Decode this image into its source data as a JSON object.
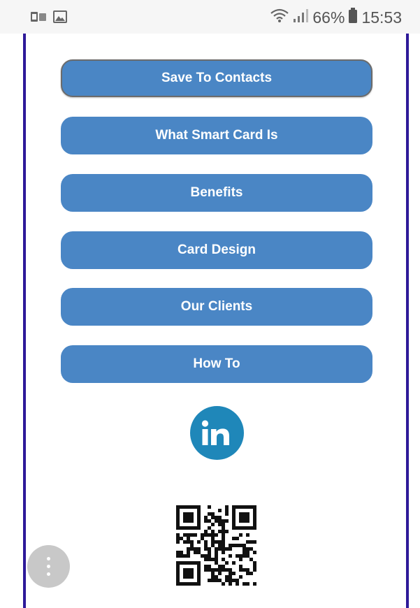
{
  "status_bar": {
    "left_icons": [
      "sim-card-icon",
      "image-icon"
    ],
    "right_icons": [
      "wifi-icon",
      "signal-icon",
      "battery-icon"
    ],
    "battery": "66%",
    "time": "15:53"
  },
  "buttons": [
    {
      "id": "save-to-contacts-button",
      "label": "Save To Contacts"
    },
    {
      "id": "what-smart-card-is-button",
      "label": "What Smart Card Is"
    },
    {
      "id": "benefits-button",
      "label": "Benefits"
    },
    {
      "id": "card-design-button",
      "label": "Card Design"
    },
    {
      "id": "our-clients-button",
      "label": "Our Clients"
    },
    {
      "id": "how-to-button",
      "label": "How To"
    }
  ],
  "social": {
    "icon": "linkedin-icon",
    "text": "in"
  },
  "qr": {
    "icon": "qr-code-icon"
  },
  "fab": {
    "icon": "more-vertical-icon"
  },
  "colors": {
    "button_bg": "#4a86c5",
    "button_text": "#ffffff",
    "frame": "#2e1a99",
    "linkedin": "#1f87b9",
    "fab": "#c8c8c8"
  }
}
